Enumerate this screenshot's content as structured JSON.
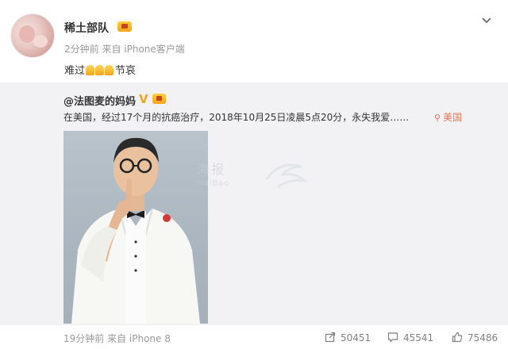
{
  "post": {
    "username": "稀土部队",
    "meta": "2分钟前 来自 iPhone客户端",
    "text_before": "难过",
    "text_after": "节哀",
    "emoji_name": "pray-emoji"
  },
  "repost": {
    "author": "@法图麦的妈妈",
    "v_mark": "V",
    "text": "在美国，经过17个月的抗癌治疗，2018年10月25日凌晨5点20分，永失我爱……",
    "location": "美国",
    "watermark": "海报",
    "watermark_sub": "HaiBao",
    "footer_time": "19分钟前 来自 iPhone 8",
    "share_count": "50451",
    "comment_count": "45541",
    "like_count": "75486"
  },
  "colors": {
    "accent": "#eb7350",
    "vip": "#f7a21b",
    "repost_bg": "#f2f2f5",
    "muted": "#999999"
  },
  "icons": [
    "chevron-down-icon",
    "location-pin-icon",
    "share-icon",
    "comment-icon",
    "like-icon",
    "vip-badge-icon"
  ]
}
